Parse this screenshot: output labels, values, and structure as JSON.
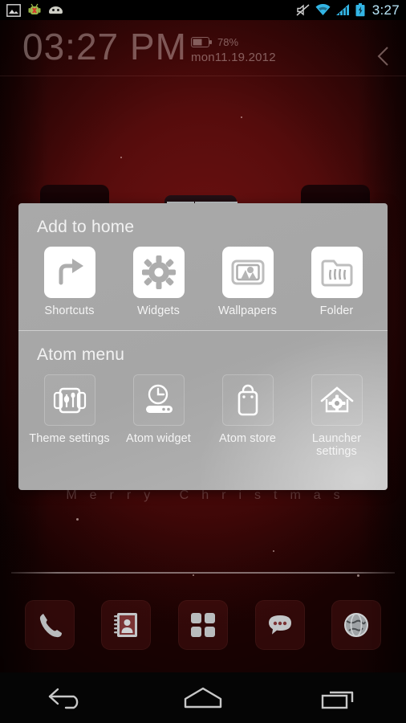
{
  "status_bar": {
    "left_icons": [
      "image-icon",
      "android-bug-icon",
      "android-head-icon"
    ],
    "right_icons": [
      "mute-icon",
      "wifi-icon",
      "signal-icon",
      "battery-charging-icon"
    ],
    "clock": "3:27",
    "accent_color": "#33b5e5"
  },
  "clock_widget": {
    "time": "03:27 PM",
    "battery_percent": "78%",
    "date": "mon11.19.2012",
    "chevron": "‹"
  },
  "wallpaper": {
    "text": "Merry Christmas",
    "background_color": "#5a0d0d"
  },
  "dialog": {
    "sections": [
      {
        "title": "Add to home",
        "style": "white-tiles",
        "items": [
          {
            "label": "Shortcuts",
            "icon": "shortcut-arrow-icon"
          },
          {
            "label": "Widgets",
            "icon": "gear-icon"
          },
          {
            "label": "Wallpapers",
            "icon": "picture-frame-icon"
          },
          {
            "label": "Folder",
            "icon": "folder-icon"
          }
        ]
      },
      {
        "title": "Atom menu",
        "style": "ghost-tiles",
        "items": [
          {
            "label": "Theme settings",
            "icon": "theme-cards-icon"
          },
          {
            "label": "Atom widget",
            "icon": "clock-widget-icon"
          },
          {
            "label": "Atom store",
            "icon": "shopping-bag-icon"
          },
          {
            "label": "Launcher settings",
            "icon": "house-gear-icon"
          }
        ]
      }
    ]
  },
  "dock": {
    "items": [
      {
        "label": "Phone",
        "icon": "phone-icon"
      },
      {
        "label": "Contacts",
        "icon": "contacts-book-icon"
      },
      {
        "label": "App drawer",
        "icon": "app-grid-icon"
      },
      {
        "label": "Messaging",
        "icon": "chat-bubble-icon"
      },
      {
        "label": "Browser",
        "icon": "globe-icon"
      }
    ]
  },
  "nav_bar": {
    "items": [
      {
        "label": "Back",
        "icon": "back-arrow-icon"
      },
      {
        "label": "Home",
        "icon": "home-icon"
      },
      {
        "label": "Recents",
        "icon": "recents-icon"
      }
    ]
  }
}
